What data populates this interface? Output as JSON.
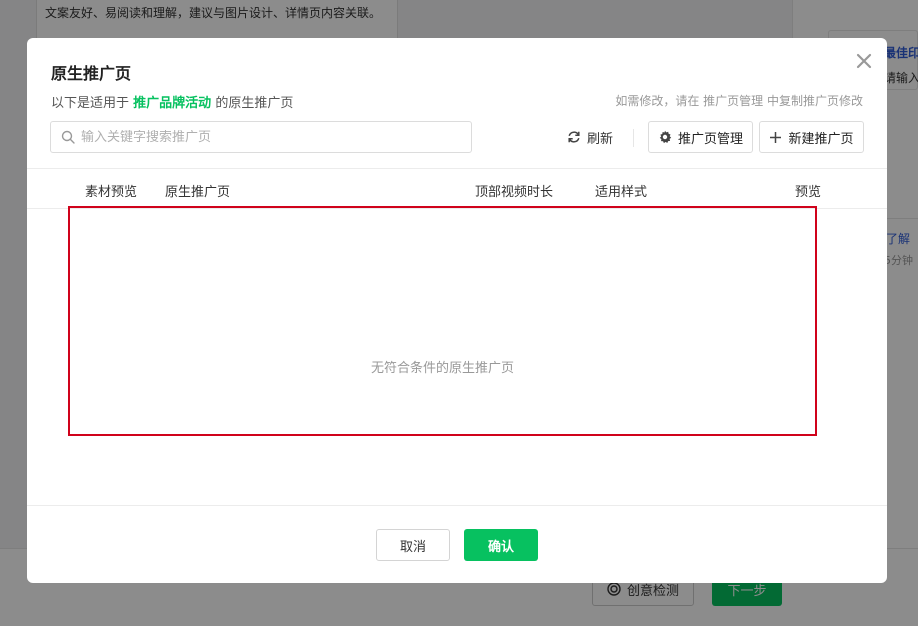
{
  "background": {
    "card_text": "文案友好、易阅读和理解，建议与图片设计、详情页内容关联。",
    "right_title": "最佳印",
    "right_sub": "请输入",
    "right_link": "了解",
    "right_note": "5分钟",
    "detect_button": "创意检测",
    "next_button": "下一步"
  },
  "dialog": {
    "title": "原生推广页",
    "subtitle_prefix": "以下是适用于",
    "subtitle_highlight": "推广品牌活动",
    "subtitle_suffix": "的原生推广页",
    "tip": "如需修改，请在 推广页管理 中复制推广页修改",
    "search_placeholder": "输入关键字搜索推广页",
    "refresh_label": "刷新",
    "manage_label": "推广页管理",
    "new_label": "新建推广页",
    "columns": [
      "素材预览",
      "原生推广页",
      "顶部视频时长",
      "适用样式",
      "预览"
    ],
    "empty_text": "无符合条件的原生推广页",
    "cancel_label": "取消",
    "confirm_label": "确认"
  },
  "colors": {
    "accent": "#07c160",
    "highlight_border": "#d0021b",
    "link": "#2e5bd8"
  }
}
